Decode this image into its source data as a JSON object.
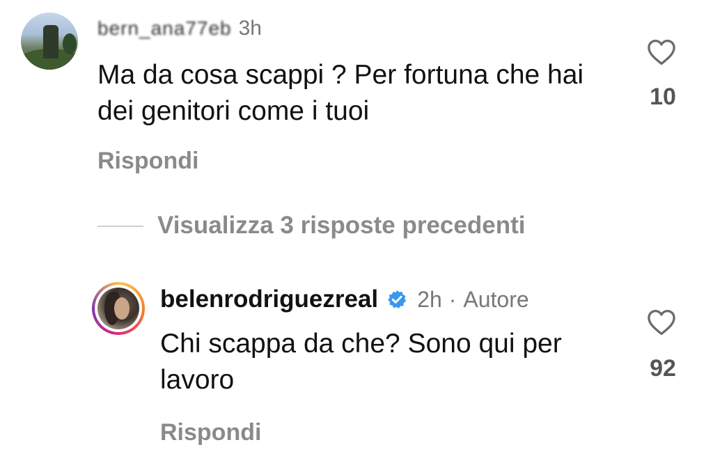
{
  "comment1": {
    "username": "bern_ana77eb",
    "time": "3h",
    "text": "Ma da cosa scappi ? Per fortuna che hai dei genitori come i tuoi",
    "reply_label": "Rispondi",
    "likes": "10"
  },
  "thread": {
    "view_replies_label": "Visualizza 3 risposte precedenti"
  },
  "comment2": {
    "username": "belenrodriguezreal",
    "time": "2h",
    "separator": "·",
    "author_label": "Autore",
    "text": "Chi scappa da che? Sono qui per lavoro",
    "reply_label": "Rispondi",
    "likes": "92"
  },
  "colors": {
    "verified_badge": "#3897f0",
    "secondary_text": "#8a8a8a"
  },
  "icons": [
    "heart-icon",
    "verified-badge-icon"
  ]
}
